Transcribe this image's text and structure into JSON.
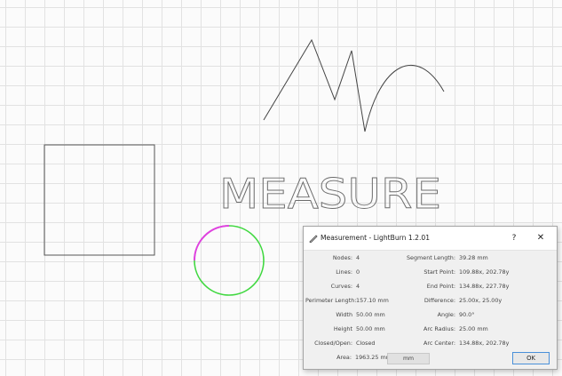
{
  "dialog": {
    "title": "Measurement - LightBurn 1.2.01",
    "help_label": "?",
    "close_label": "✕",
    "left_fields": [
      {
        "label": "Nodes:",
        "value": "4"
      },
      {
        "label": "Lines:",
        "value": "0"
      },
      {
        "label": "Curves:",
        "value": "4"
      },
      {
        "label": "Perimeter Length:",
        "value": "157.10 mm"
      },
      {
        "label": "Width",
        "value": "50.00 mm"
      },
      {
        "label": "Height",
        "value": "50.00 mm"
      },
      {
        "label": "Closed/Open:",
        "value": "Closed"
      }
    ],
    "right_fields": [
      {
        "label": "Segment Length:",
        "value": "39.28 mm"
      },
      {
        "label": "Start Point:",
        "value": "109.88x, 202.78y"
      },
      {
        "label": "End Point:",
        "value": "134.88x, 227.78y"
      },
      {
        "label": "Difference:",
        "value": "25.00x, 25.00y"
      },
      {
        "label": "Angle:",
        "value": "90.0°"
      },
      {
        "label": "Arc Radius:",
        "value": "25.00 mm"
      },
      {
        "label": "Arc Center:",
        "value": "134.88x, 202.78y"
      }
    ],
    "area_label": "Area:",
    "area_value": "1963.25 mm^2",
    "unit": "mm",
    "ok_label": "OK"
  },
  "canvas": {
    "text_object": "MEASURE",
    "colors": {
      "outline": "#555555",
      "selected_segment": "#e040e0",
      "circle": "#40d840",
      "grid": "#e2e2e2"
    }
  }
}
